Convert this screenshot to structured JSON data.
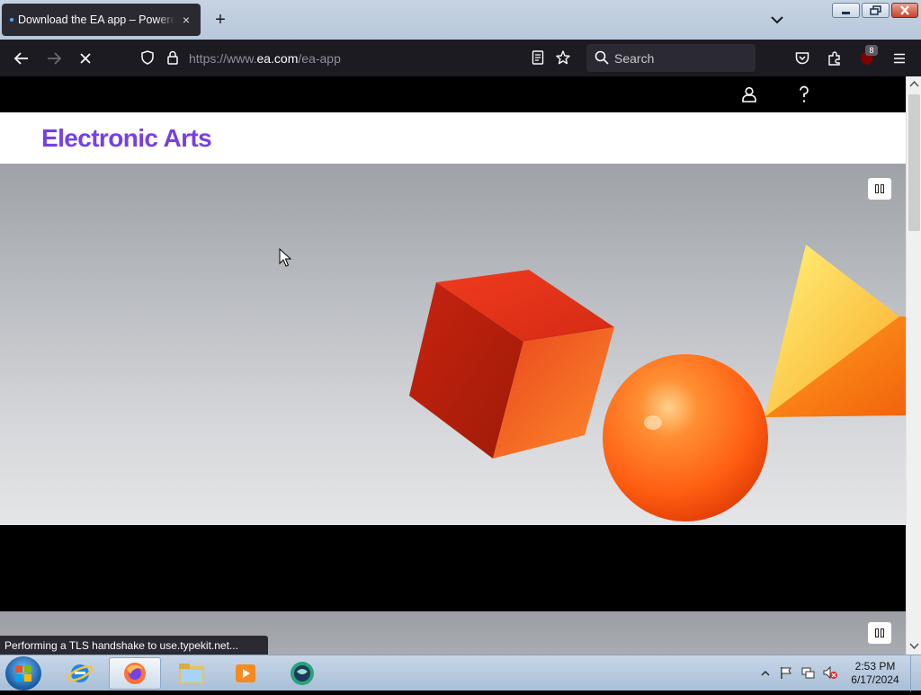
{
  "browser": {
    "tab": {
      "title": "Download the EA app – Powered by EA",
      "close_glyph": "×"
    },
    "new_tab_glyph": "+",
    "url": {
      "prefix": "https://www.",
      "host": "ea.com",
      "path": "/ea-app"
    },
    "search": {
      "placeholder": "Search"
    },
    "extensions_badge": "8",
    "status_text": "Performing a TLS handshake to use.typekit.net..."
  },
  "page": {
    "brand": "Electronic Arts",
    "accent_color": "#7640e6"
  },
  "taskbar": {
    "apps": [
      "internet-explorer",
      "firefox",
      "file-explorer",
      "media-player",
      "app-bubble"
    ],
    "clock": {
      "time": "2:53 PM",
      "date": "6/17/2024"
    }
  }
}
